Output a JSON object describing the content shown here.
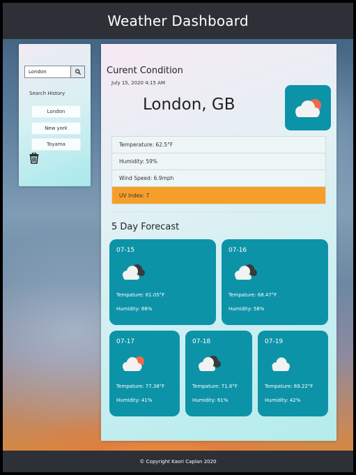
{
  "header": {
    "title": "Weather Dashboard"
  },
  "sidebar": {
    "search": {
      "value": "London",
      "button_icon": "search-icon"
    },
    "history_title": "Search History",
    "history": [
      "London",
      "New york",
      "Toyama"
    ],
    "trash_icon": "trash-icon"
  },
  "current": {
    "title": "Curent Condition",
    "date": "July 15, 2020 4:15 AM",
    "city": "London, GB",
    "icon": "cloud-sun-icon",
    "stats": {
      "temperature": "Temperature: 62.5°F",
      "humidity": "Humidity: 59%",
      "wind": "Wind Speed: 6.9mph",
      "uv": "UV Index: 7"
    },
    "uv_color": "#f59f2a",
    "accent": "#0d93a8"
  },
  "forecast": {
    "title": "5 Day Forecast",
    "days": [
      {
        "date": "07-15",
        "icon": "cloud-dark-icon",
        "temp": "Tempature: 61.05°F",
        "humidity": "Humidity: 68%"
      },
      {
        "date": "07-16",
        "icon": "cloud-dark-icon",
        "temp": "Tempature: 68.47°F",
        "humidity": "Humidity: 58%"
      },
      {
        "date": "07-17",
        "icon": "cloud-sun-icon",
        "temp": "Tempature: 77.38°F",
        "humidity": "Humidity: 41%"
      },
      {
        "date": "07-18",
        "icon": "cloud-dark-icon",
        "temp": "Tempature: 71.8°F",
        "humidity": "Humidity: 61%"
      },
      {
        "date": "07-19",
        "icon": "cloud-icon",
        "temp": "Tempature: 69.22°F",
        "humidity": "Humidity: 42%"
      }
    ]
  },
  "footer": {
    "text": "© Copyright Kaori Caplan 2020"
  }
}
